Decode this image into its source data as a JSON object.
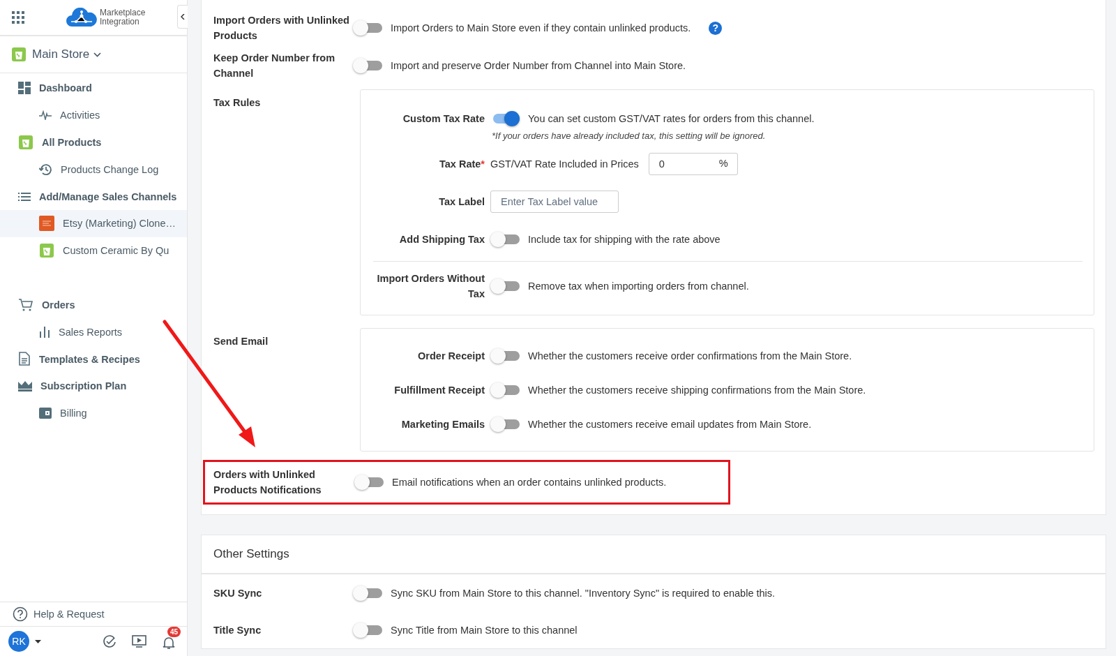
{
  "sidebar": {
    "app_name": "Marketplace Integration",
    "store": "Main Store",
    "nav_groups": [
      [
        {
          "label": "Dashboard",
          "kind": "main",
          "selected": false
        },
        {
          "label": "Activities",
          "kind": "sub",
          "selected": false
        },
        {
          "label": "All Products",
          "kind": "main",
          "selected": false
        },
        {
          "label": "Products Change Log",
          "kind": "sub",
          "selected": false
        },
        {
          "label": "Add/Manage Sales Channels",
          "kind": "main",
          "selected": false
        },
        {
          "label": "Etsy (Marketing) Clone…",
          "kind": "sub",
          "selected": true
        },
        {
          "label": "Custom Ceramic By Qu",
          "kind": "sub",
          "selected": false
        }
      ],
      [
        {
          "label": "Orders",
          "kind": "main",
          "selected": false
        },
        {
          "label": "Sales Reports",
          "kind": "sub",
          "selected": false
        },
        {
          "label": "Templates & Recipes",
          "kind": "main",
          "selected": false
        },
        {
          "label": "Subscription Plan",
          "kind": "main",
          "selected": false
        },
        {
          "label": "Billing",
          "kind": "sub",
          "selected": false
        }
      ]
    ],
    "help": "Help & Request",
    "avatar": "RK",
    "notification_count": "45"
  },
  "order_settings": {
    "rows": [
      {
        "label": "Import Orders with Unlinked Products",
        "on": false,
        "description": "Import Orders to Main Store even if they contain unlinked products.",
        "help": "?"
      },
      {
        "label": "Keep Order Number from Channel",
        "on": false,
        "description": "Import and preserve Order Number from Channel into Main Store."
      }
    ],
    "tax_rules": {
      "label": "Tax Rules",
      "groups": [
        [
          {
            "kind": "toggle",
            "label": "Custom Tax Rate",
            "on": true,
            "description": "You can set custom GST/VAT rates for orders from this channel.",
            "note": "*If your orders have already included tax, this setting will be ignored."
          },
          {
            "kind": "rate",
            "label": "Tax Rate",
            "required_mark": "*",
            "description": "GST/VAT Rate Included in Prices",
            "value": "0",
            "unit": "%"
          },
          {
            "kind": "text",
            "label": "Tax Label",
            "placeholder": "Enter Tax Label value"
          },
          {
            "kind": "toggle",
            "label": "Add Shipping Tax",
            "on": false,
            "description": "Include tax for shipping with the rate above"
          }
        ],
        [
          {
            "kind": "toggle",
            "label": "Import Orders Without Tax",
            "on": false,
            "description": "Remove tax when importing orders from channel."
          }
        ]
      ]
    },
    "send_email": {
      "label": "Send Email",
      "rows": [
        {
          "label": "Order Receipt",
          "on": false,
          "description": "Whether the customers receive order confirmations from the Main Store."
        },
        {
          "label": "Fulfillment Receipt",
          "on": false,
          "description": "Whether the customers receive shipping confirmations from the Main Store."
        },
        {
          "label": "Marketing Emails",
          "on": false,
          "description": "Whether the customers receive email updates from Main Store."
        }
      ]
    },
    "unlinked_notifications": {
      "label": "Orders with Unlinked Products Notifications",
      "on": false,
      "description": "Email notifications when an order contains unlinked products.",
      "highlighted": true
    }
  },
  "other_settings": {
    "title": "Other Settings",
    "rows": [
      {
        "label": "SKU Sync",
        "on": false,
        "description": "Sync SKU from Main Store to this channel. \"Inventory Sync\" is required to enable this."
      },
      {
        "label": "Title Sync",
        "on": false,
        "description": "Sync Title from Main Store to this channel"
      }
    ]
  }
}
